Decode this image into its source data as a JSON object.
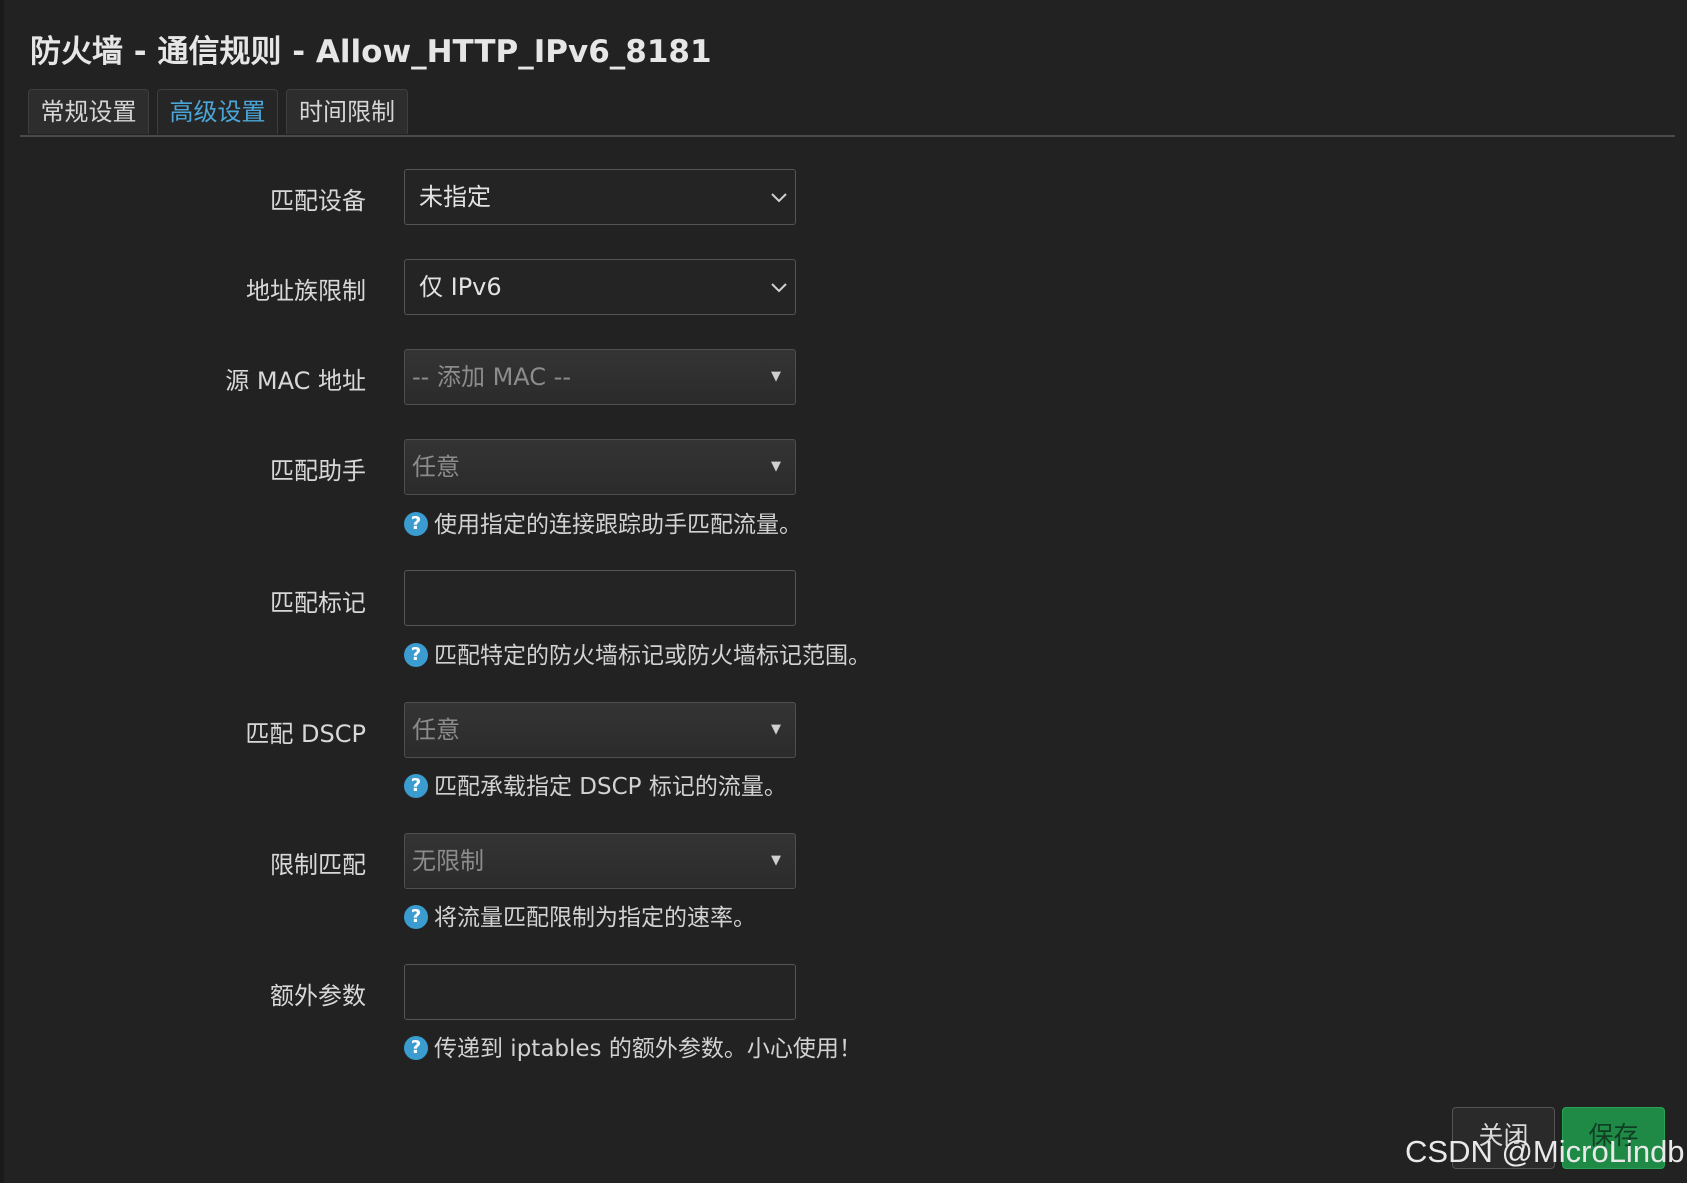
{
  "title": "防火墙 - 通信规则 - Allow_HTTP_IPv6_8181",
  "tabs": [
    {
      "label": "常规设置",
      "active": false
    },
    {
      "label": "高级设置",
      "active": true
    },
    {
      "label": "时间限制",
      "active": false
    }
  ],
  "fields": {
    "match_device": {
      "label": "匹配设备",
      "value": "未指定"
    },
    "family": {
      "label": "地址族限制",
      "value": "仅 IPv6"
    },
    "src_mac": {
      "label": "源 MAC 地址",
      "placeholder": "-- 添加 MAC --"
    },
    "helper": {
      "label": "匹配助手",
      "value": "任意",
      "help": "使用指定的连接跟踪助手匹配流量。"
    },
    "mark": {
      "label": "匹配标记",
      "value": "",
      "help": "匹配特定的防火墙标记或防火墙标记范围。"
    },
    "dscp": {
      "label": "匹配 DSCP",
      "value": "任意",
      "help": "匹配承载指定 DSCP 标记的流量。"
    },
    "limit": {
      "label": "限制匹配",
      "value": "无限制",
      "help": "将流量匹配限制为指定的速率。"
    },
    "extra": {
      "label": "额外参数",
      "value": "",
      "help": "传递到 iptables 的额外参数。小心使用！"
    }
  },
  "help_icon": "?",
  "buttons": {
    "close": "关闭",
    "save": "保存"
  },
  "watermark": "CSDN @MicroLindb",
  "colors": {
    "accent": "#4aa6d8",
    "save": "#1f8a46",
    "background": "#222222"
  }
}
